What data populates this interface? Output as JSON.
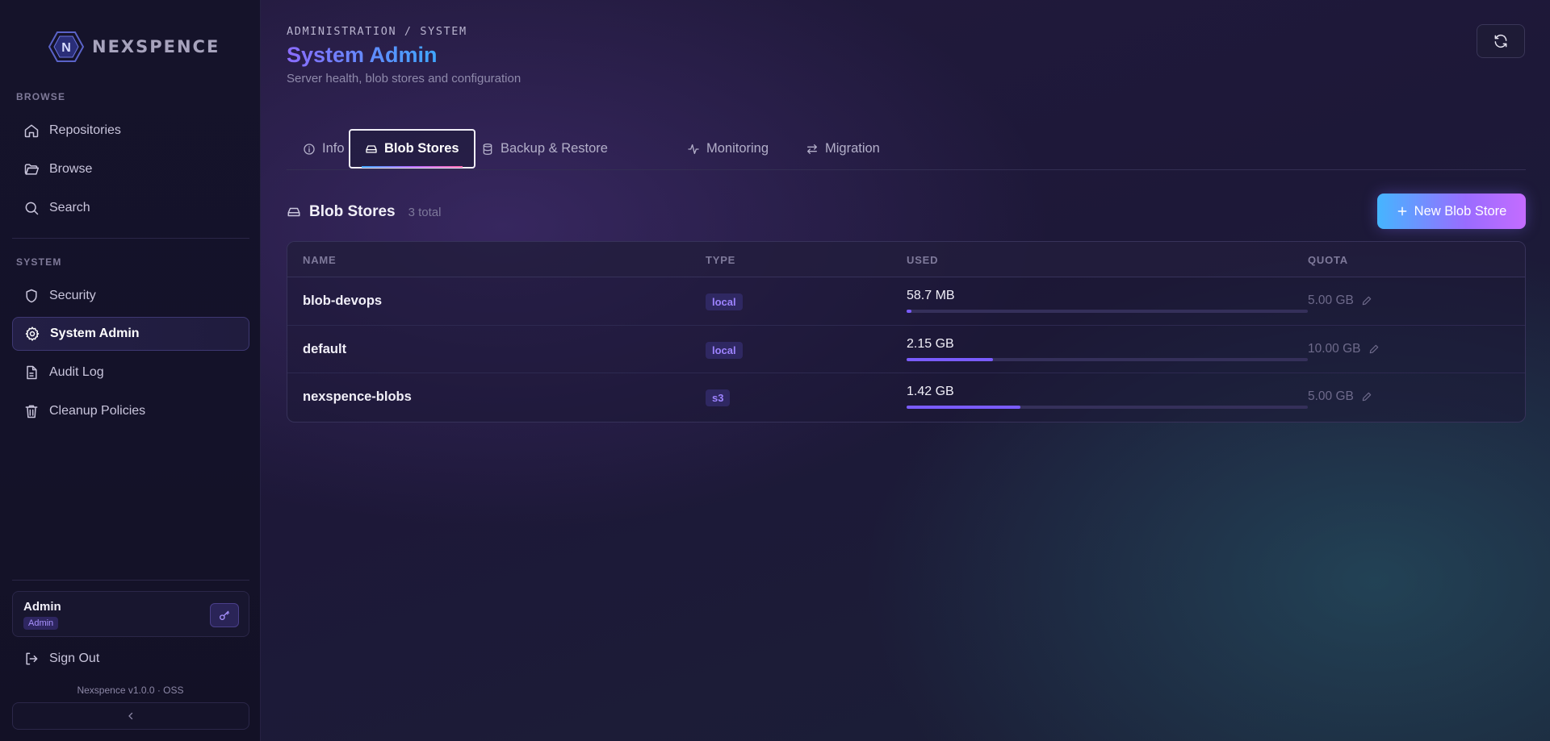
{
  "app": {
    "name": "NEXSPENCE",
    "logo_letter": "N"
  },
  "sidebar": {
    "browse_label": "BROWSE",
    "browse_items": [
      {
        "label": "Repositories",
        "icon": "home-icon"
      },
      {
        "label": "Browse",
        "icon": "folder-open-icon"
      },
      {
        "label": "Search",
        "icon": "search-icon"
      }
    ],
    "system_label": "SYSTEM",
    "system_items": [
      {
        "label": "Security",
        "icon": "shield-icon"
      },
      {
        "label": "System Admin",
        "icon": "gear-icon",
        "active": true
      },
      {
        "label": "Audit Log",
        "icon": "document-icon"
      },
      {
        "label": "Cleanup Policies",
        "icon": "trash-icon"
      }
    ],
    "user": {
      "name": "Admin",
      "role": "Admin"
    },
    "sign_out": "Sign Out",
    "version": "Nexspence v1.0.0 · OSS"
  },
  "header": {
    "breadcrumb": "ADMINISTRATION / SYSTEM",
    "title": "System Admin",
    "subtitle": "Server health, blob stores and configuration"
  },
  "tabs": [
    {
      "label": "Info",
      "icon": "info-icon"
    },
    {
      "label": "Blob Stores",
      "icon": "drive-icon",
      "active": true
    },
    {
      "label": "Backup & Restore",
      "icon": "database-icon"
    },
    {
      "label": "Monitoring",
      "icon": "activity-icon"
    },
    {
      "label": "Migration",
      "icon": "arrows-swap-icon"
    }
  ],
  "blob_stores": {
    "title": "Blob Stores",
    "count": "3 total",
    "new_button": "New Blob Store",
    "columns": [
      "NAME",
      "TYPE",
      "USED",
      "QUOTA"
    ],
    "rows": [
      {
        "name": "blob-devops",
        "type": "local",
        "used": "58.7 MB",
        "used_fraction": 0.012,
        "quota": "5.00 GB"
      },
      {
        "name": "default",
        "type": "local",
        "used": "2.15 GB",
        "used_fraction": 0.215,
        "quota": "10.00 GB"
      },
      {
        "name": "nexspence-blobs",
        "type": "s3",
        "used": "1.42 GB",
        "used_fraction": 0.284,
        "quota": "5.00 GB"
      }
    ]
  },
  "colors": {
    "accent": "#7a5cff",
    "accent_blue": "#3fa6ff"
  }
}
